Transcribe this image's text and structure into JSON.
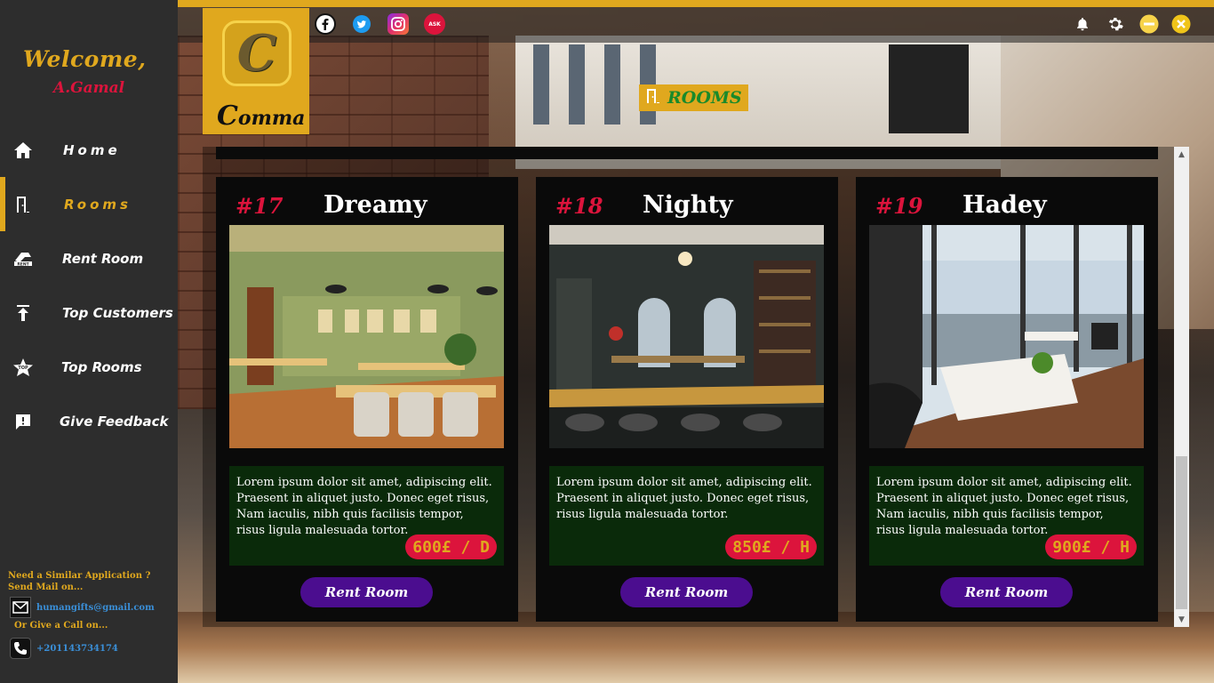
{
  "sidebar": {
    "welcome": "Welcome,",
    "username": "A.Gamal",
    "items": [
      {
        "label": "Home",
        "icon": "home-icon"
      },
      {
        "label": "Rooms",
        "icon": "door-icon"
      },
      {
        "label": "Rent Room",
        "icon": "rent-icon"
      },
      {
        "label": "Top Customers",
        "icon": "upload-arrow-icon"
      },
      {
        "label": "Top Rooms",
        "icon": "top-star-icon"
      },
      {
        "label": "Give Feedback",
        "icon": "feedback-icon"
      }
    ],
    "active_item": "Rooms",
    "contact": {
      "heading_line1": "Need a Similar Application ?",
      "heading_line2": "Send Mail on...",
      "email": "humangifts@gmail.com",
      "call_heading": "Or Give a Call on...",
      "phone": "+201143734174"
    }
  },
  "logo": {
    "mark": "C",
    "text_first": "C",
    "text_rest": "omma"
  },
  "page_title": "ROOMS",
  "social_icons": [
    "facebook-icon",
    "twitter-icon",
    "instagram-icon",
    "askfm-icon"
  ],
  "system_icons": [
    "bell-icon",
    "gear-icon",
    "minimize-icon",
    "close-icon"
  ],
  "colors": {
    "accent": "#e0a81e",
    "price_bg": "#dc143c",
    "button": "#4b0d8f",
    "title_text": "#1a8a2a"
  },
  "rooms": [
    {
      "number": "#17",
      "name": "Dreamy",
      "description": "Lorem ipsum dolor sit amet, adipiscing elit. Praesent in aliquet justo. Donec eget risus, Nam iaculis, nibh quis facilisis tempor, risus ligula malesuada tortor.",
      "price": "600£ / D",
      "button": "Rent Room"
    },
    {
      "number": "#18",
      "name": "Nighty",
      "description": "Lorem ipsum dolor sit amet, adipiscing elit. Praesent in aliquet justo. Donec eget risus, risus ligula malesuada tortor.",
      "price": "850£ / H",
      "button": "Rent Room"
    },
    {
      "number": "#19",
      "name": "Hadey",
      "description": "Lorem ipsum dolor sit amet, adipiscing elit. Praesent in aliquet justo. Donec eget risus, Nam iaculis, nibh quis facilisis tempor, risus ligula malesuada tortor.",
      "price": "900£ / H",
      "button": "Rent Room"
    }
  ]
}
